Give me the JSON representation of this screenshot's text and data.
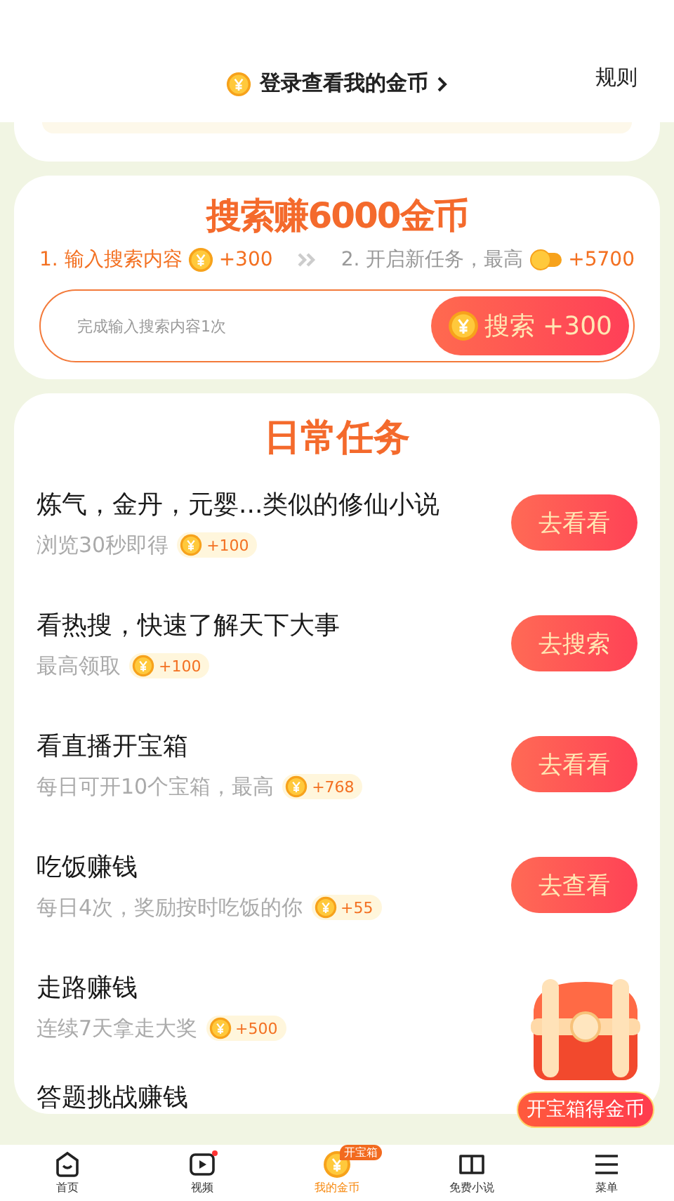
{
  "header": {
    "login_text": "登录查看我的金币",
    "rules": "规则"
  },
  "search_card": {
    "title": "搜索赚6000金币",
    "step1": {
      "label": "1. 输入搜索内容",
      "reward": "+300"
    },
    "step2": {
      "label": "2. 开启新任务，最高",
      "reward": "+5700"
    },
    "input": {
      "placeholder": "完成输入搜索内容1次"
    },
    "button": "搜索 +300"
  },
  "daily": {
    "title": "日常任务",
    "tasks": [
      {
        "title": "炼气，金丹，元婴...类似的修仙小说",
        "subtitle": "浏览30秒即得",
        "reward": "+100",
        "button": "去看看"
      },
      {
        "title": "看热搜，快速了解天下大事",
        "subtitle": "最高领取",
        "reward": "+100",
        "button": "去搜索"
      },
      {
        "title": "看直播开宝箱",
        "subtitle": "每日可开10个宝箱，最高",
        "reward": "+768",
        "button": "去看看"
      },
      {
        "title": "吃饭赚钱",
        "subtitle": "每日4次，奖励按时吃饭的你",
        "reward": "+55",
        "button": "去查看"
      },
      {
        "title": "走路赚钱",
        "subtitle": "连续7天拿走大奖",
        "reward": "+500"
      },
      {
        "title": "答题挑战赚钱"
      }
    ]
  },
  "float_chest": {
    "label": "开宝箱得金币"
  },
  "bottom_nav": [
    {
      "label": "首页",
      "kind": "home",
      "selected": false
    },
    {
      "label": "视频",
      "kind": "video",
      "selected": false,
      "dot": true
    },
    {
      "label": "我的金币",
      "kind": "coin",
      "selected": true,
      "badge": "开宝箱"
    },
    {
      "label": "免费小说",
      "kind": "book",
      "selected": false
    },
    {
      "label": "菜单",
      "kind": "menu",
      "selected": false
    }
  ]
}
